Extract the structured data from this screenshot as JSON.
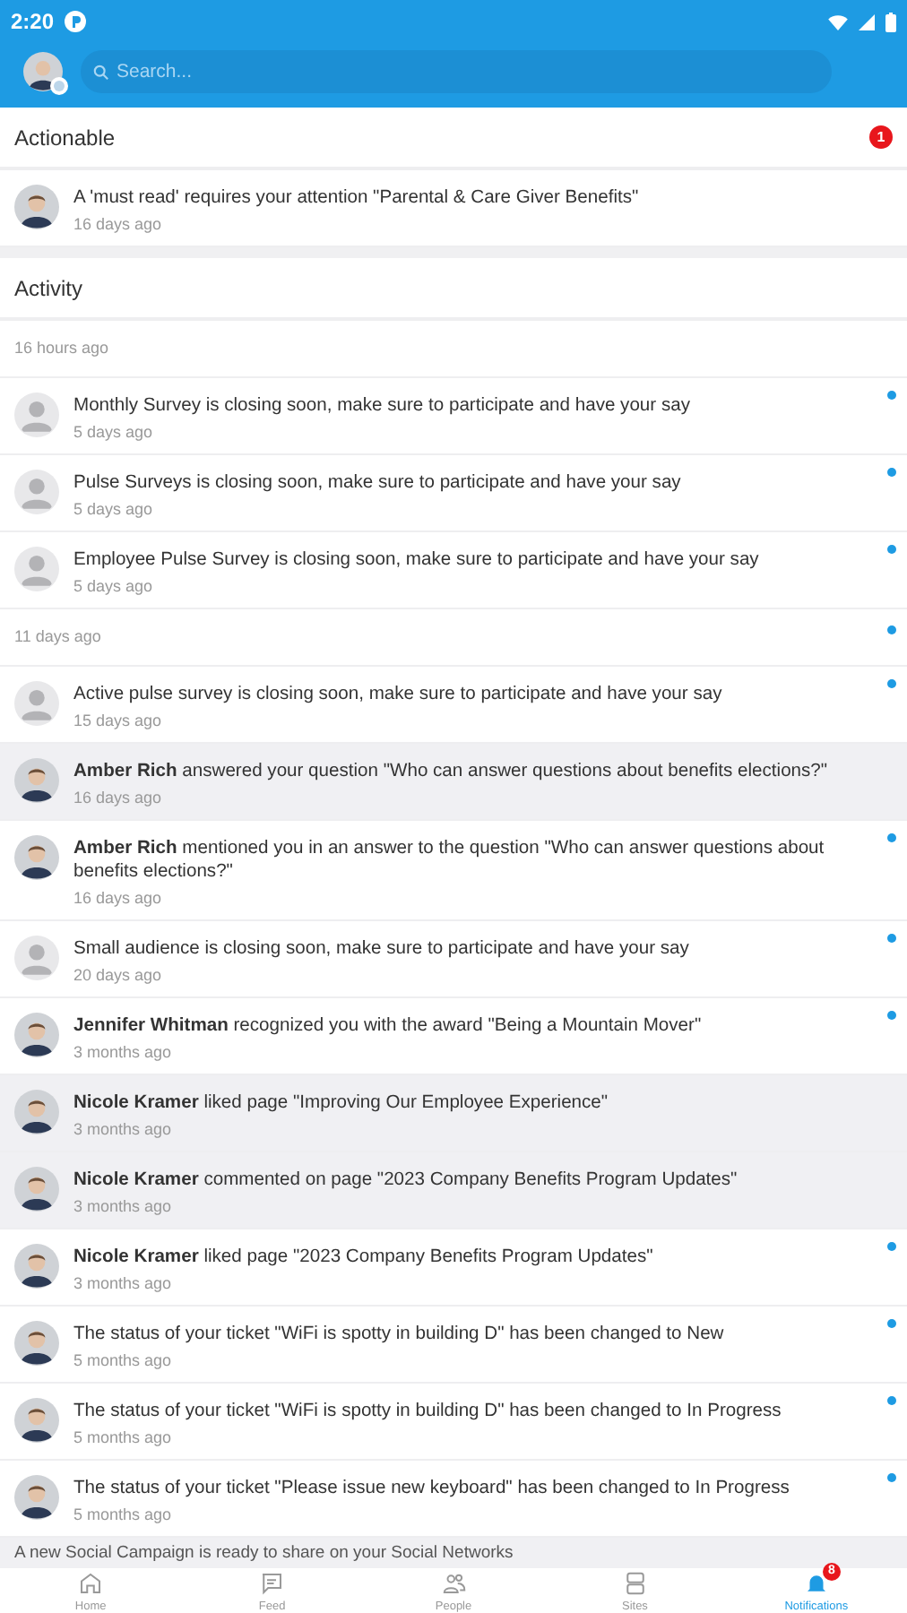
{
  "status_bar": {
    "time": "2:20"
  },
  "header": {
    "search": {
      "placeholder": "Search..."
    }
  },
  "actionable": {
    "title": "Actionable",
    "badge": "1",
    "items": [
      {
        "avatar": {
          "kind": "person"
        },
        "text": "A 'must read' requires your attention \"Parental & Care Giver Benefits\"",
        "time": "16 days ago"
      }
    ]
  },
  "activity": {
    "title": "Activity",
    "items": [
      {
        "kind": "date",
        "text": "16 hours ago",
        "unread": false
      },
      {
        "kind": "notification",
        "avatar": {
          "kind": "default"
        },
        "text": "Monthly Survey is closing soon, make sure to participate and have your say",
        "time": "5 days ago",
        "unread": true
      },
      {
        "kind": "notification",
        "avatar": {
          "kind": "default"
        },
        "text": "Pulse Surveys is closing soon, make sure to participate and have your say",
        "time": "5 days ago",
        "unread": true
      },
      {
        "kind": "notification",
        "avatar": {
          "kind": "default"
        },
        "text": "Employee Pulse Survey is closing soon, make sure to participate and have your say",
        "time": "5 days ago",
        "unread": true
      },
      {
        "kind": "date",
        "text": "11 days ago",
        "unread": true
      },
      {
        "kind": "notification",
        "avatar": {
          "kind": "default"
        },
        "text": "Active pulse survey is closing soon, make sure to participate and have your say",
        "time": "15 days ago",
        "unread": true
      },
      {
        "kind": "notification",
        "avatar": {
          "kind": "person"
        },
        "text": "**Amber Rich** answered your question \"Who can answer questions about benefits elections?\"",
        "time": "16 days ago",
        "unread": false
      },
      {
        "kind": "notification",
        "avatar": {
          "kind": "person"
        },
        "text": "**Amber Rich** mentioned you in an answer to the question \"Who can answer questions about benefits elections?\"",
        "time": "16 days ago",
        "unread": true
      },
      {
        "kind": "notification",
        "avatar": {
          "kind": "default"
        },
        "text": "Small audience is closing soon, make sure to participate and have your say",
        "time": "20 days ago",
        "unread": true
      },
      {
        "kind": "notification",
        "avatar": {
          "kind": "person"
        },
        "text": "**Jennifer Whitman** recognized you with the award \"Being a Mountain Mover\"",
        "time": "3 months ago",
        "unread": true
      },
      {
        "kind": "notification",
        "avatar": {
          "kind": "person"
        },
        "text": "**Nicole Kramer** liked page \"Improving Our Employee Experience\"",
        "time": "3 months ago",
        "unread": false
      },
      {
        "kind": "notification",
        "avatar": {
          "kind": "person"
        },
        "text": "**Nicole Kramer** commented on page \"2023 Company Benefits Program Updates\"",
        "time": "3 months ago",
        "unread": false
      },
      {
        "kind": "notification",
        "avatar": {
          "kind": "person"
        },
        "text": "**Nicole Kramer** liked page \"2023 Company Benefits Program Updates\"",
        "time": "3 months ago",
        "unread": true
      },
      {
        "kind": "notification",
        "avatar": {
          "kind": "person"
        },
        "text": "The status of your ticket \"WiFi is spotty in building D\" has been changed to New",
        "time": "5 months ago",
        "unread": true
      },
      {
        "kind": "notification",
        "avatar": {
          "kind": "person"
        },
        "text": "The status of your ticket \"WiFi is spotty in building D\" has been changed to In Progress",
        "time": "5 months ago",
        "unread": true
      },
      {
        "kind": "notification",
        "avatar": {
          "kind": "person"
        },
        "text": "The status of your ticket \"Please issue new keyboard\" has been changed to In Progress",
        "time": "5 months ago",
        "unread": true
      },
      {
        "kind": "banner",
        "text": "A new Social Campaign is ready to share on your Social Networks"
      }
    ]
  },
  "bottom_nav": [
    {
      "label": "Home",
      "selected": false
    },
    {
      "label": "Feed",
      "selected": false
    },
    {
      "label": "People",
      "selected": false
    },
    {
      "label": "Sites",
      "selected": false
    },
    {
      "label": "Notifications",
      "selected": true,
      "badge": "8"
    }
  ]
}
